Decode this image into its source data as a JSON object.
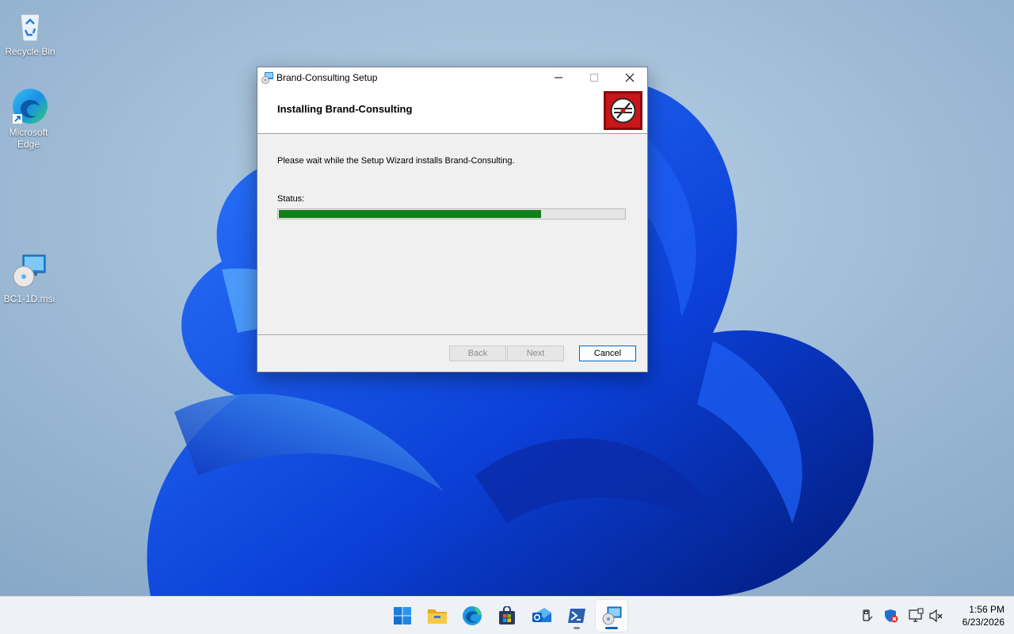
{
  "desktop": {
    "icons": [
      {
        "label": "Recycle Bin",
        "icon": "recycle-bin-icon"
      },
      {
        "label": "Microsoft Edge",
        "icon": "edge-icon"
      },
      {
        "label": "BC1-1D.msi",
        "icon": "msi-installer-icon"
      }
    ]
  },
  "dialog": {
    "title": "Brand-Consulting Setup",
    "heading": "Installing Brand-Consulting",
    "description": "Please wait while the Setup Wizard installs Brand-Consulting.",
    "status_label": "Status:",
    "progress": 0.76,
    "progress_color": "#11801a",
    "buttons": {
      "back": "Back",
      "next": "Next",
      "cancel": "Cancel"
    },
    "logo_color": "#c8161b"
  },
  "taskbar": {
    "apps": [
      {
        "name": "start",
        "icon": "windows-start-icon"
      },
      {
        "name": "file-explorer",
        "icon": "folder-icon"
      },
      {
        "name": "edge",
        "icon": "edge-icon"
      },
      {
        "name": "store",
        "icon": "store-icon"
      },
      {
        "name": "outlook",
        "icon": "outlook-icon"
      },
      {
        "name": "powershell",
        "icon": "powershell-icon"
      },
      {
        "name": "setup",
        "icon": "installer-icon"
      }
    ],
    "tray": [
      "usb-icon",
      "security-alert-icon",
      "network-icon",
      "volume-muted-icon"
    ],
    "time": "1:56 PM",
    "date": "6/23/2026"
  }
}
